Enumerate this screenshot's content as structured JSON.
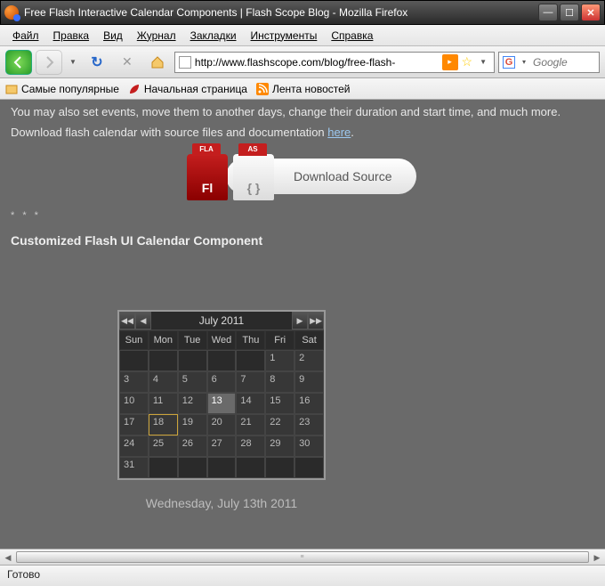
{
  "window": {
    "title": "Free Flash Interactive Calendar Components | Flash Scope Blog - Mozilla Firefox"
  },
  "menu": {
    "file": "Файл",
    "edit": "Правка",
    "view": "Вид",
    "history": "Журнал",
    "bookmarks": "Закладки",
    "tools": "Инструменты",
    "help": "Справка"
  },
  "nav": {
    "url": "http://www.flashscope.com/blog/free-flash-",
    "search_placeholder": "Google"
  },
  "bookmarks": {
    "popular": "Самые популярные",
    "home": "Начальная страница",
    "feed": "Лента новостей"
  },
  "content": {
    "line1": "You may also set events, move them to another days, change their duration and start time, and much more.",
    "line2_pre": "Download flash calendar with source files and documentation ",
    "line2_link": "here",
    "line2_post": ".",
    "download_label": "Download Source",
    "fla_tab": "FLA",
    "as_tab": "AS",
    "fl_label": "Fl",
    "as_label": "{ }",
    "stars": "* * *",
    "subheading": "Customized Flash UI Calendar Component",
    "date_label": "Wednesday, July 13th 2011"
  },
  "calendar": {
    "title": "July  2011",
    "days": [
      "Sun",
      "Mon",
      "Tue",
      "Wed",
      "Thu",
      "Fri",
      "Sat"
    ],
    "weeks": [
      [
        "",
        "",
        "",
        "",
        "",
        "1",
        "2"
      ],
      [
        "3",
        "4",
        "5",
        "6",
        "7",
        "8",
        "9"
      ],
      [
        "10",
        "11",
        "12",
        "13",
        "14",
        "15",
        "16"
      ],
      [
        "17",
        "18",
        "19",
        "20",
        "21",
        "22",
        "23"
      ],
      [
        "24",
        "25",
        "26",
        "27",
        "28",
        "29",
        "30"
      ],
      [
        "31",
        "",
        "",
        "",
        "",
        "",
        ""
      ]
    ],
    "selected": "13",
    "today": "18"
  },
  "status": {
    "text": "Готово"
  }
}
